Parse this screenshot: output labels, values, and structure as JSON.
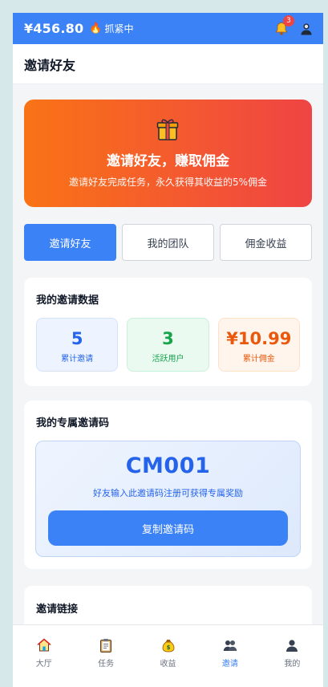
{
  "topbar": {
    "balance": "¥456.80",
    "status_icon": "fire-icon",
    "status_label": "抓紧中",
    "notification_count": "3"
  },
  "header": {
    "title": "邀请好友"
  },
  "hero": {
    "icon": "gift-icon",
    "title": "邀请好友，赚取佣金",
    "subtitle": "邀请好友完成任务，永久获得其收益的5%佣金"
  },
  "tabs": [
    {
      "label": "邀请好友",
      "active": true
    },
    {
      "label": "我的团队",
      "active": false
    },
    {
      "label": "佣金收益",
      "active": false
    }
  ],
  "stats_card": {
    "title": "我的邀请数据",
    "items": [
      {
        "value": "5",
        "label": "累计邀请",
        "color": "#2563eb"
      },
      {
        "value": "3",
        "label": "活跃用户",
        "color": "#16a34a"
      },
      {
        "value": "¥10.99",
        "label": "累计佣金",
        "color": "#ea580c"
      }
    ]
  },
  "code_card": {
    "title": "我的专属邀请码",
    "code": "CM001",
    "hint": "好友输入此邀请码注册可获得专属奖励",
    "copy_label": "复制邀请码"
  },
  "link_card": {
    "title": "邀请链接"
  },
  "bottom_nav": [
    {
      "label": "大厅",
      "icon": "home-icon",
      "active": false
    },
    {
      "label": "任务",
      "icon": "clipboard-icon",
      "active": false
    },
    {
      "label": "收益",
      "icon": "money-bag-icon",
      "active": false
    },
    {
      "label": "邀请",
      "icon": "users-icon",
      "active": true
    },
    {
      "label": "我的",
      "icon": "user-icon",
      "active": false
    }
  ],
  "colors": {
    "primary": "#3b82f6",
    "hero_start": "#f97316",
    "hero_end": "#ef4444"
  }
}
